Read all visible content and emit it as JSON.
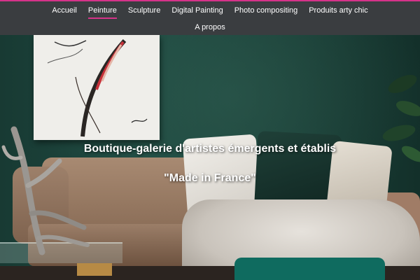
{
  "nav": {
    "items": [
      {
        "label": "Accueil",
        "active": false
      },
      {
        "label": "Peinture",
        "active": true
      },
      {
        "label": "Sculpture",
        "active": false
      },
      {
        "label": "Digital Painting",
        "active": false
      },
      {
        "label": "Photo compositing",
        "active": false
      },
      {
        "label": "Produits arty chic",
        "active": false
      }
    ],
    "second_row": [
      {
        "label": "A propos",
        "active": false
      }
    ],
    "accent_color": "#d6338a",
    "background_color": "#3a3d40"
  },
  "hero": {
    "title": "Boutique-galerie d'artistes émergents et établis",
    "subtitle": "\"Made in France\""
  }
}
